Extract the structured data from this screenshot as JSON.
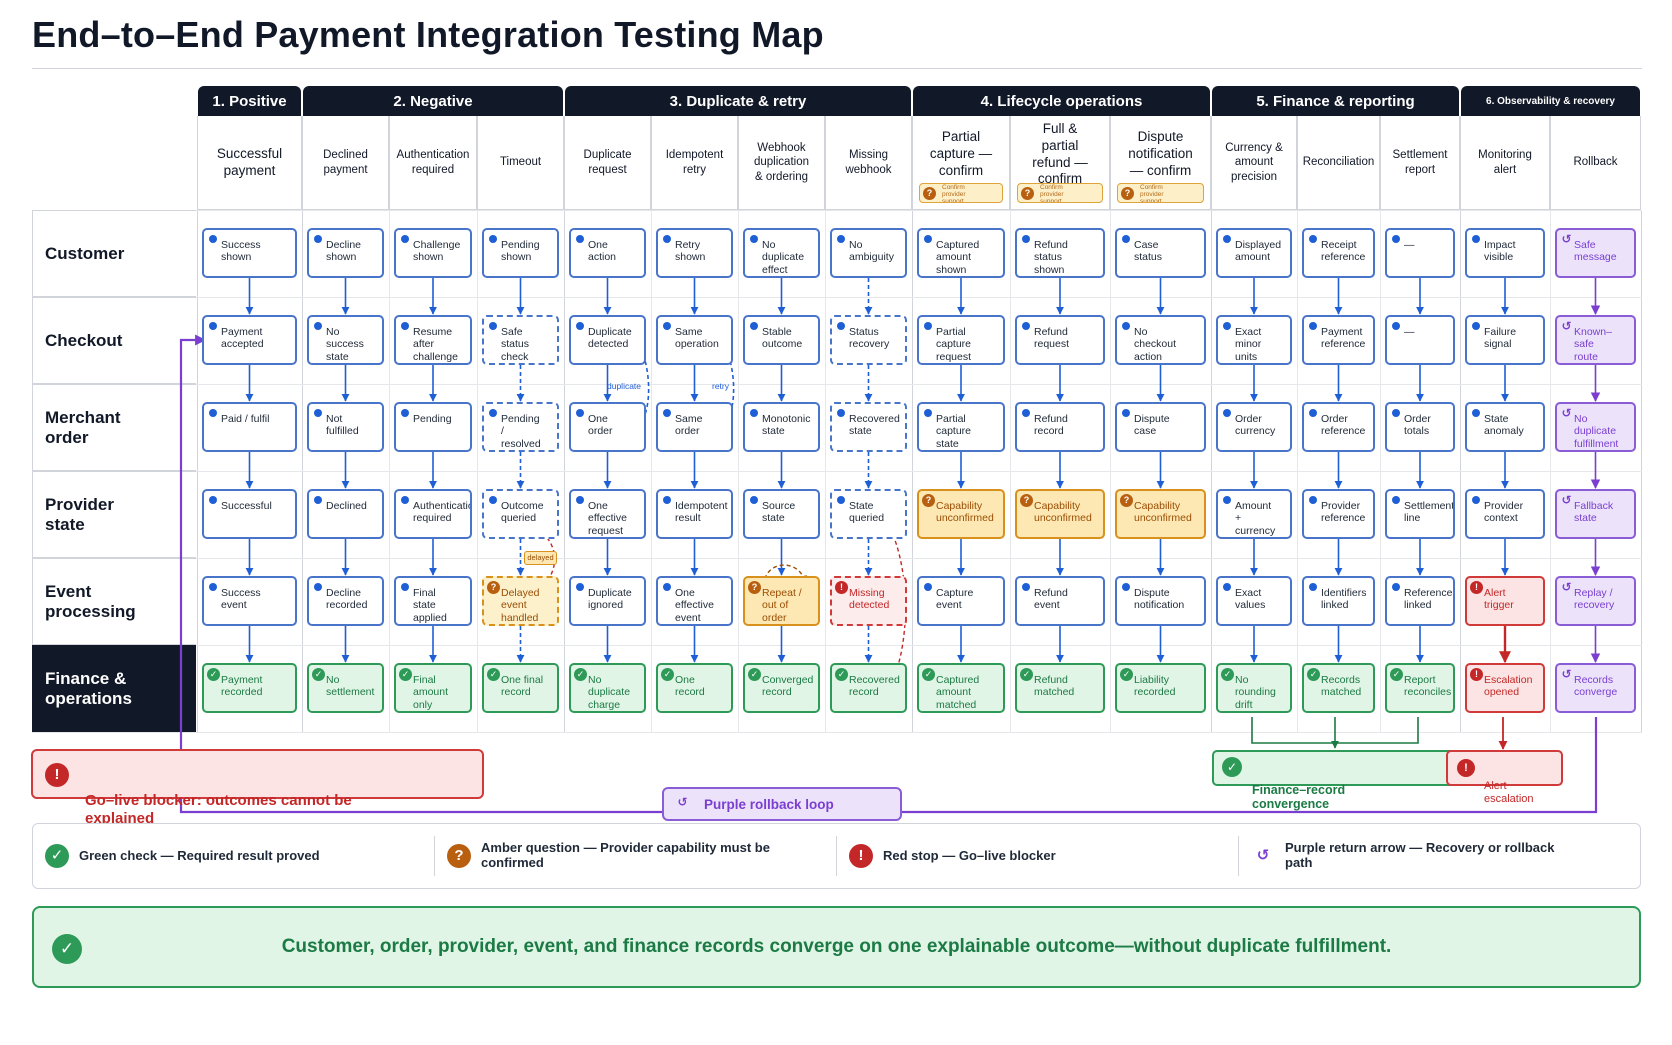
{
  "title": "End–to–End Payment Integration Testing Map",
  "groups": [
    {
      "label": "1. Positive"
    },
    {
      "label": "2. Negative"
    },
    {
      "label": "3. Duplicate & retry"
    },
    {
      "label": "4. Lifecycle operations"
    },
    {
      "label": "5. Finance & reporting"
    },
    {
      "label": "6. Observability & recovery"
    }
  ],
  "columns": [
    {
      "label": "Successful\npayment"
    },
    {
      "label": "Declined\npayment"
    },
    {
      "label": "Authentication\nrequired"
    },
    {
      "label": "Timeout"
    },
    {
      "label": "Duplicate\nrequest"
    },
    {
      "label": "Idempotent\nretry"
    },
    {
      "label": "Webhook\nduplication\n& ordering"
    },
    {
      "label": "Missing\nwebhook"
    },
    {
      "label": "Partial\ncapture —\nconfirm",
      "badge": "Confirm\nprovider\nsupport"
    },
    {
      "label": "Full &\npartial\nrefund —\nconfirm",
      "badge": "Confirm\nprovider\nsupport"
    },
    {
      "label": "Dispute\nnotification\n— confirm",
      "badge": "Confirm\nprovider\nsupport"
    },
    {
      "label": "Currency &\namount\nprecision"
    },
    {
      "label": "Reconciliation"
    },
    {
      "label": "Settlement\nreport"
    },
    {
      "label": "Monitoring\nalert"
    },
    {
      "label": "Rollback"
    }
  ],
  "rows": [
    {
      "label": "Customer"
    },
    {
      "label": "Checkout"
    },
    {
      "label": "Merchant\norder"
    },
    {
      "label": "Provider\nstate"
    },
    {
      "label": "Event\nprocessing"
    },
    {
      "label": "Finance &\noperations"
    }
  ],
  "cells": [
    [
      {
        "text": "Success\nshown",
        "kind": "blue"
      },
      {
        "text": "Decline\nshown",
        "kind": "blue"
      },
      {
        "text": "Challenge\nshown",
        "kind": "blue"
      },
      {
        "text": "Pending\nshown",
        "kind": "blue"
      },
      {
        "text": "One\naction",
        "kind": "blue"
      },
      {
        "text": "Retry\nshown",
        "kind": "blue"
      },
      {
        "text": "No\nduplicate\neffect",
        "kind": "blue"
      },
      {
        "text": "No\nambiguity",
        "kind": "blue"
      },
      {
        "text": "Captured\namount\nshown",
        "kind": "blue"
      },
      {
        "text": "Refund\nstatus\nshown",
        "kind": "blue"
      },
      {
        "text": "Case\nstatus",
        "kind": "blue"
      },
      {
        "text": "Displayed\namount",
        "kind": "blue"
      },
      {
        "text": "Receipt\nreference",
        "kind": "blue"
      },
      {
        "text": "—",
        "kind": "blue"
      },
      {
        "text": "Impact\nvisible",
        "kind": "blue"
      },
      {
        "text": "Safe\nmessage",
        "kind": "purple"
      }
    ],
    [
      {
        "text": "Payment\naccepted",
        "kind": "blue"
      },
      {
        "text": "No\nsuccess\nstate",
        "kind": "blue"
      },
      {
        "text": "Resume\nafter\nchallenge",
        "kind": "blue"
      },
      {
        "text": "Safe\nstatus\ncheck",
        "kind": "blue"
      },
      {
        "text": "Duplicate\ndetected",
        "kind": "blue"
      },
      {
        "text": "Same\noperation",
        "kind": "blue"
      },
      {
        "text": "Stable\noutcome",
        "kind": "blue"
      },
      {
        "text": "Status\nrecovery",
        "kind": "blue"
      },
      {
        "text": "Partial\ncapture\nrequest",
        "kind": "blue"
      },
      {
        "text": "Refund\nrequest",
        "kind": "blue"
      },
      {
        "text": "No\ncheckout\naction",
        "kind": "blue"
      },
      {
        "text": "Exact\nminor\nunits",
        "kind": "blue"
      },
      {
        "text": "Payment\nreference",
        "kind": "blue"
      },
      {
        "text": "—",
        "kind": "blue"
      },
      {
        "text": "Failure\nsignal",
        "kind": "blue"
      },
      {
        "text": "Known–safe\nroute",
        "kind": "purple"
      }
    ],
    [
      {
        "text": "Paid / fulfil",
        "kind": "blue"
      },
      {
        "text": "Not\nfulfilled",
        "kind": "blue"
      },
      {
        "text": "Pending",
        "kind": "blue"
      },
      {
        "text": "Pending\n/\nresolved",
        "kind": "blue"
      },
      {
        "text": "One\norder",
        "kind": "blue"
      },
      {
        "text": "Same\norder",
        "kind": "blue"
      },
      {
        "text": "Monotonic\nstate",
        "kind": "blue"
      },
      {
        "text": "Recovered\nstate",
        "kind": "blue"
      },
      {
        "text": "Partial\ncapture\nstate",
        "kind": "blue"
      },
      {
        "text": "Refund\nrecord",
        "kind": "blue"
      },
      {
        "text": "Dispute\ncase",
        "kind": "blue"
      },
      {
        "text": "Order\ncurrency",
        "kind": "blue"
      },
      {
        "text": "Order\nreference",
        "kind": "blue"
      },
      {
        "text": "Order\ntotals",
        "kind": "blue"
      },
      {
        "text": "State\nanomaly",
        "kind": "blue"
      },
      {
        "text": "No\nduplicate\nfulfillment",
        "kind": "purple"
      }
    ],
    [
      {
        "text": "Successful",
        "kind": "blue"
      },
      {
        "text": "Declined",
        "kind": "blue"
      },
      {
        "text": "Authentication\nrequired",
        "kind": "blue"
      },
      {
        "text": "Outcome\nqueried",
        "kind": "blue"
      },
      {
        "text": "One\neffective\nrequest",
        "kind": "blue"
      },
      {
        "text": "Idempotent\nresult",
        "kind": "blue"
      },
      {
        "text": "Source\nstate",
        "kind": "blue"
      },
      {
        "text": "State\nqueried",
        "kind": "blue"
      },
      {
        "text": "Capability\nunconfirmed",
        "kind": "amber"
      },
      {
        "text": "Capability\nunconfirmed",
        "kind": "amber"
      },
      {
        "text": "Capability\nunconfirmed",
        "kind": "amber"
      },
      {
        "text": "Amount\n+\ncurrency",
        "kind": "blue"
      },
      {
        "text": "Provider\nreference",
        "kind": "blue"
      },
      {
        "text": "Settlement\nline",
        "kind": "blue"
      },
      {
        "text": "Provider\ncontext",
        "kind": "blue"
      },
      {
        "text": "Fallback\nstate",
        "kind": "purple"
      }
    ],
    [
      {
        "text": "Success\nevent",
        "kind": "blue"
      },
      {
        "text": "Decline\nrecorded",
        "kind": "blue"
      },
      {
        "text": "Final\nstate\napplied",
        "kind": "blue"
      },
      {
        "text": "Delayed\nevent\nhandled",
        "kind": "amber-dash"
      },
      {
        "text": "Duplicate\nignored",
        "kind": "blue"
      },
      {
        "text": "One\neffective\nevent",
        "kind": "blue"
      },
      {
        "text": "Repeat /\nout of\norder",
        "kind": "amber"
      },
      {
        "text": "Missing\ndetected",
        "kind": "red-dash"
      },
      {
        "text": "Capture\nevent",
        "kind": "blue"
      },
      {
        "text": "Refund\nevent",
        "kind": "blue"
      },
      {
        "text": "Dispute\nnotification",
        "kind": "blue"
      },
      {
        "text": "Exact\nvalues",
        "kind": "blue"
      },
      {
        "text": "Identifiers\nlinked",
        "kind": "blue"
      },
      {
        "text": "References\nlinked",
        "kind": "blue"
      },
      {
        "text": "Alert\ntrigger",
        "kind": "red"
      },
      {
        "text": "Replay /\nrecovery",
        "kind": "purple"
      }
    ],
    [
      {
        "text": "Payment\nrecorded",
        "kind": "green"
      },
      {
        "text": "No\nsettlement",
        "kind": "green"
      },
      {
        "text": "Final\namount\nonly",
        "kind": "green"
      },
      {
        "text": "One final\nrecord",
        "kind": "green"
      },
      {
        "text": "No\nduplicate\ncharge",
        "kind": "green"
      },
      {
        "text": "One\nrecord",
        "kind": "green"
      },
      {
        "text": "Converged\nrecord",
        "kind": "green"
      },
      {
        "text": "Recovered\nrecord",
        "kind": "green"
      },
      {
        "text": "Captured\namount\nmatched",
        "kind": "green"
      },
      {
        "text": "Refund\nmatched",
        "kind": "green"
      },
      {
        "text": "Liability\nrecorded",
        "kind": "green"
      },
      {
        "text": "No\nrounding\ndrift",
        "kind": "green"
      },
      {
        "text": "Records\nmatched",
        "kind": "green"
      },
      {
        "text": "Report\nreconciles",
        "kind": "green"
      },
      {
        "text": "Escalation\nopened",
        "kind": "red"
      },
      {
        "text": "Records\nconverge",
        "kind": "purple"
      }
    ]
  ],
  "loop_labels": {
    "duplicate": "duplicate",
    "retry": "retry",
    "delayed": "delayed"
  },
  "blocker": "Go–live blocker: outcomes cannot be\nexplained",
  "rollback_loop": "Purple rollback loop",
  "finance_convergence": "Finance–record\nconvergence",
  "alert_escalation": "Alert\nescalation",
  "legend": [
    {
      "text": "Green check — Required result proved",
      "icon": "green-check-icon"
    },
    {
      "text": "Amber question — Provider capability must be\nconfirmed",
      "icon": "amber-question-icon"
    },
    {
      "text": "Red stop — Go–live blocker",
      "icon": "red-stop-icon"
    },
    {
      "text": "Purple return arrow — Recovery or rollback\npath",
      "icon": "purple-return-arrow-icon"
    }
  ],
  "banner": "Customer, order, provider, event, and finance records converge on one explainable outcome—without duplicate fulfillment.",
  "colors": {
    "header": "#111827",
    "blue": "#4874c9",
    "green": "#2e9a57",
    "amber": "#d9911d",
    "red": "#d03a3a",
    "purple": "#8a5cd6"
  }
}
